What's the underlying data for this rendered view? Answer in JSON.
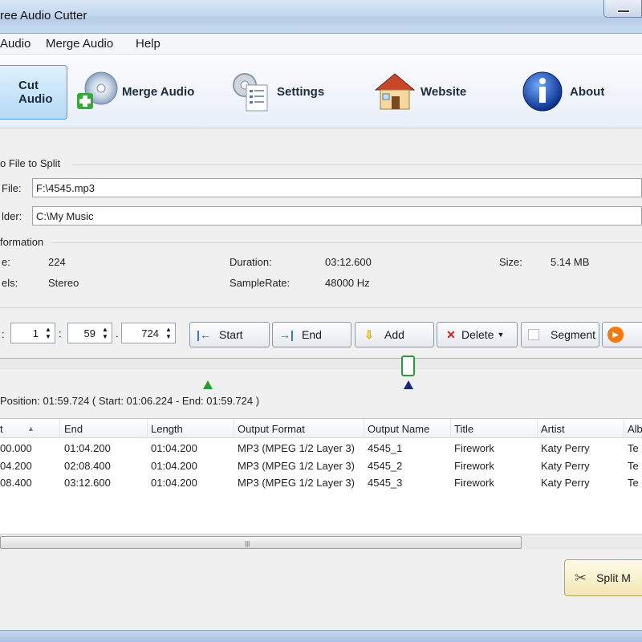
{
  "window": {
    "title": "ree Audio Cutter"
  },
  "menu": [
    "Audio",
    "Merge Audio",
    "Help"
  ],
  "toolbar": {
    "items": [
      {
        "label": "Cut Audio",
        "icon": "scissors-icon"
      },
      {
        "label": "Merge Audio",
        "icon": "cd-merge-icon"
      },
      {
        "label": "Settings",
        "icon": "settings-gear-icon"
      },
      {
        "label": "Website",
        "icon": "house-icon"
      },
      {
        "label": "About",
        "icon": "info-icon"
      }
    ]
  },
  "file_section": {
    "heading": "o File to Split",
    "file_label": "File:",
    "file_value": "F:\\4545.mp3",
    "folder_label": "lder:",
    "folder_value": "C:\\My Music"
  },
  "info": {
    "heading": "formation",
    "bitrate_label": "e:",
    "bitrate_value": "224",
    "channels_label": "els:",
    "channels_value": "Stereo",
    "duration_label": "Duration:",
    "duration_value": "03:12.600",
    "samplerate_label": "SampleRate:",
    "samplerate_value": "48000 Hz",
    "size_label": "Size:",
    "size_value": "5.14 MB"
  },
  "controls": {
    "time_label": ":",
    "minutes": "1",
    "sep1": ":",
    "seconds": "59",
    "sep2": ".",
    "millis": "724",
    "buttons": {
      "start": "Start",
      "end": "End",
      "add": "Add",
      "delete": "Delete",
      "segment": "Segment"
    }
  },
  "position_text": "Position: 01:59.724 ( Start: 01:06.224 - End: 01:59.724 )",
  "position_fraction": 0.623,
  "table": {
    "columns": [
      "t",
      "End",
      "Length",
      "Output Format",
      "Output Name",
      "Title",
      "Artist",
      "Alb"
    ],
    "rows": [
      [
        "00.000",
        "01:04.200",
        "01:04.200",
        "MP3 (MPEG 1/2 Layer 3)",
        "4545_1",
        "Firework",
        "Katy Perry",
        "Te"
      ],
      [
        "04.200",
        "02:08.400",
        "01:04.200",
        "MP3 (MPEG 1/2 Layer 3)",
        "4545_2",
        "Firework",
        "Katy Perry",
        "Te"
      ],
      [
        "08.400",
        "03:12.600",
        "01:04.200",
        "MP3 (MPEG 1/2 Layer 3)",
        "4545_3",
        "Firework",
        "Katy Perry",
        "Te"
      ]
    ]
  },
  "split_button": "Split M"
}
